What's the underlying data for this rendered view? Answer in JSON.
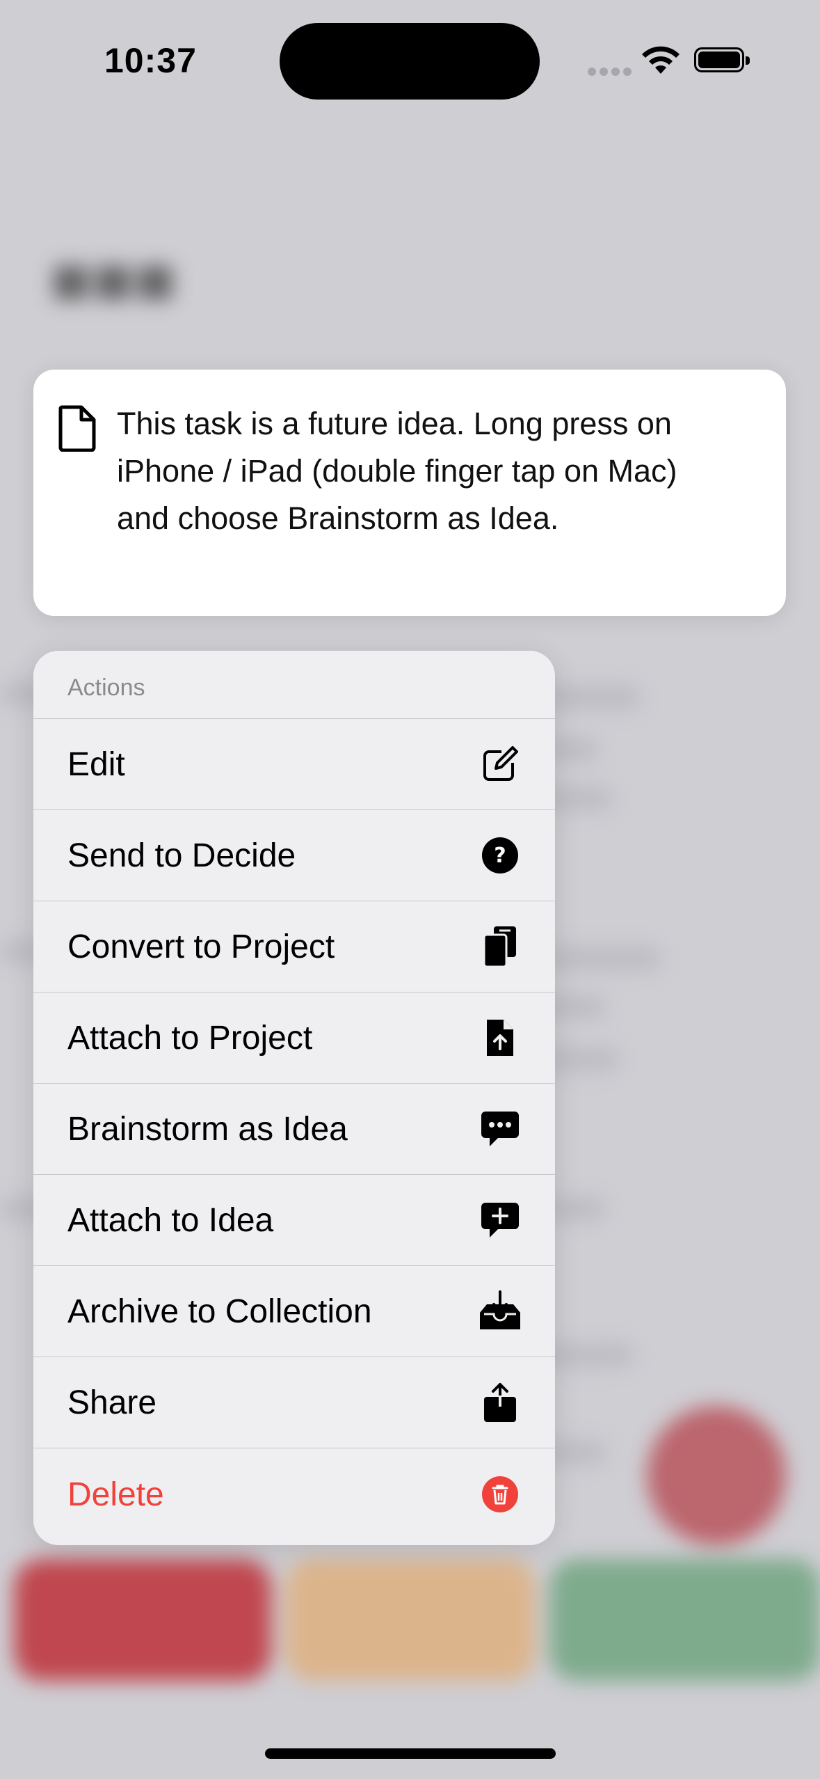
{
  "status_bar": {
    "time": "10:37"
  },
  "preview": {
    "icon": "document-icon",
    "text": "This task is a future idea. Long press on iPhone / iPad (double finger tap on Mac) and choose Brainstorm as Idea."
  },
  "menu": {
    "header": "Actions",
    "items": [
      {
        "label": "Edit",
        "icon": "square-pencil-icon"
      },
      {
        "label": "Send to Decide",
        "icon": "question-circle-icon"
      },
      {
        "label": "Convert to Project",
        "icon": "documents-icon"
      },
      {
        "label": "Attach to Project",
        "icon": "document-upload-icon"
      },
      {
        "label": "Brainstorm as Idea",
        "icon": "speech-bubble-ellipsis-icon"
      },
      {
        "label": "Attach to Idea",
        "icon": "speech-bubble-plus-icon"
      },
      {
        "label": "Archive to Collection",
        "icon": "tray-download-icon"
      },
      {
        "label": "Share",
        "icon": "share-icon"
      },
      {
        "label": "Delete",
        "icon": "trash-circle-icon",
        "destructive": true,
        "color": "#F0423A"
      }
    ]
  }
}
